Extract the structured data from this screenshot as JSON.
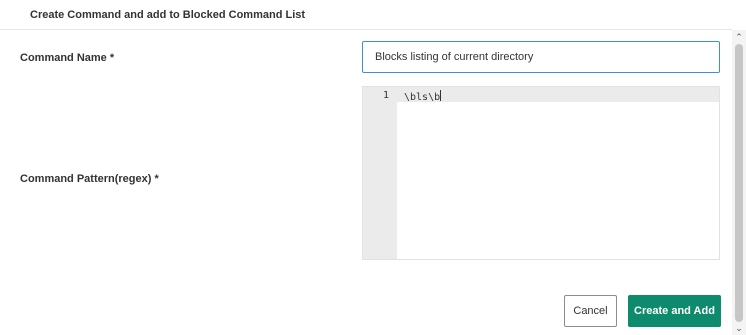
{
  "dialog": {
    "title": "Create Command and add to Blocked Command List"
  },
  "form": {
    "command_name": {
      "label": "Command Name *",
      "value": "Blocks listing of current directory"
    },
    "command_pattern": {
      "label": "Command Pattern(regex) *",
      "line_number": "1",
      "value": "\\bls\\b"
    }
  },
  "buttons": {
    "cancel_label": "Cancel",
    "create_label": "Create and Add"
  },
  "icons": {
    "scroll_up": "chevron-up-icon",
    "scroll_down": "chevron-down-icon"
  },
  "colors": {
    "primary_button": "#0e8a6c",
    "input_focus_border": "#3d8fd6"
  }
}
